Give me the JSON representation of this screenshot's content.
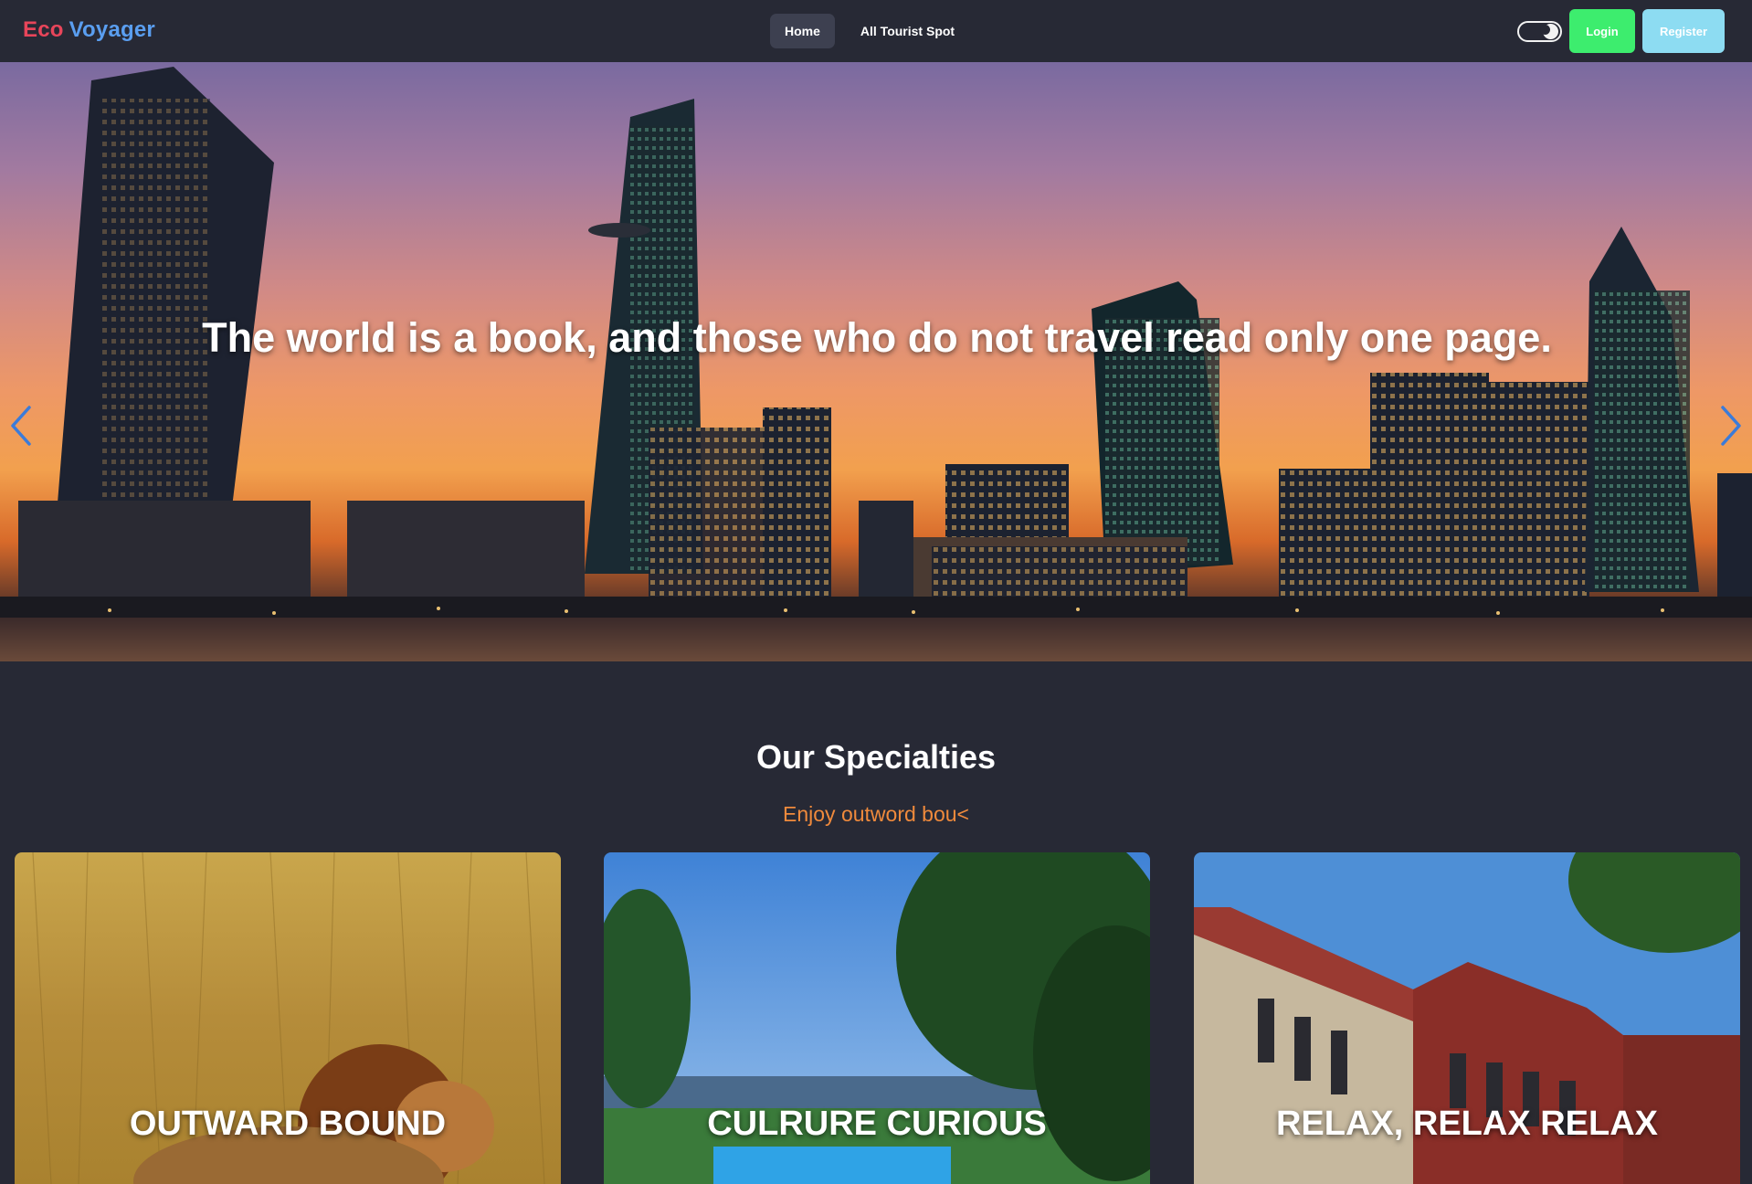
{
  "navbar": {
    "brand_part1": "Eco",
    "brand_part2": "Voyager",
    "links": [
      {
        "label": "Home",
        "active": true
      },
      {
        "label": "All Tourist Spot",
        "active": false
      }
    ],
    "theme_toggle_state": "dark",
    "login_label": "Login",
    "register_label": "Register"
  },
  "hero": {
    "quote": "The world is a book, and those who do not travel read only one page.",
    "image_subject": "city skyline at sunset",
    "prev_icon": "chevron-left-icon",
    "next_icon": "chevron-right-icon"
  },
  "specialties": {
    "title": "Our Specialties",
    "subtitle": "Enjoy outword bou<",
    "cards": [
      {
        "label": "OUTWARD BOUND",
        "image_subject": "lion in tall grass"
      },
      {
        "label": "CULRURE CURIOUS",
        "image_subject": "pool among trees"
      },
      {
        "label": "RELAX, RELAX RELAX",
        "image_subject": "brick buildings and tree"
      }
    ]
  },
  "colors": {
    "background": "#272935",
    "brand_eco": "#e8455a",
    "brand_voyager": "#5a9ef0",
    "login": "#3ded6e",
    "register": "#8ddcf2",
    "subtitle": "#f08a3c",
    "arrows": "#3b7bd9"
  }
}
